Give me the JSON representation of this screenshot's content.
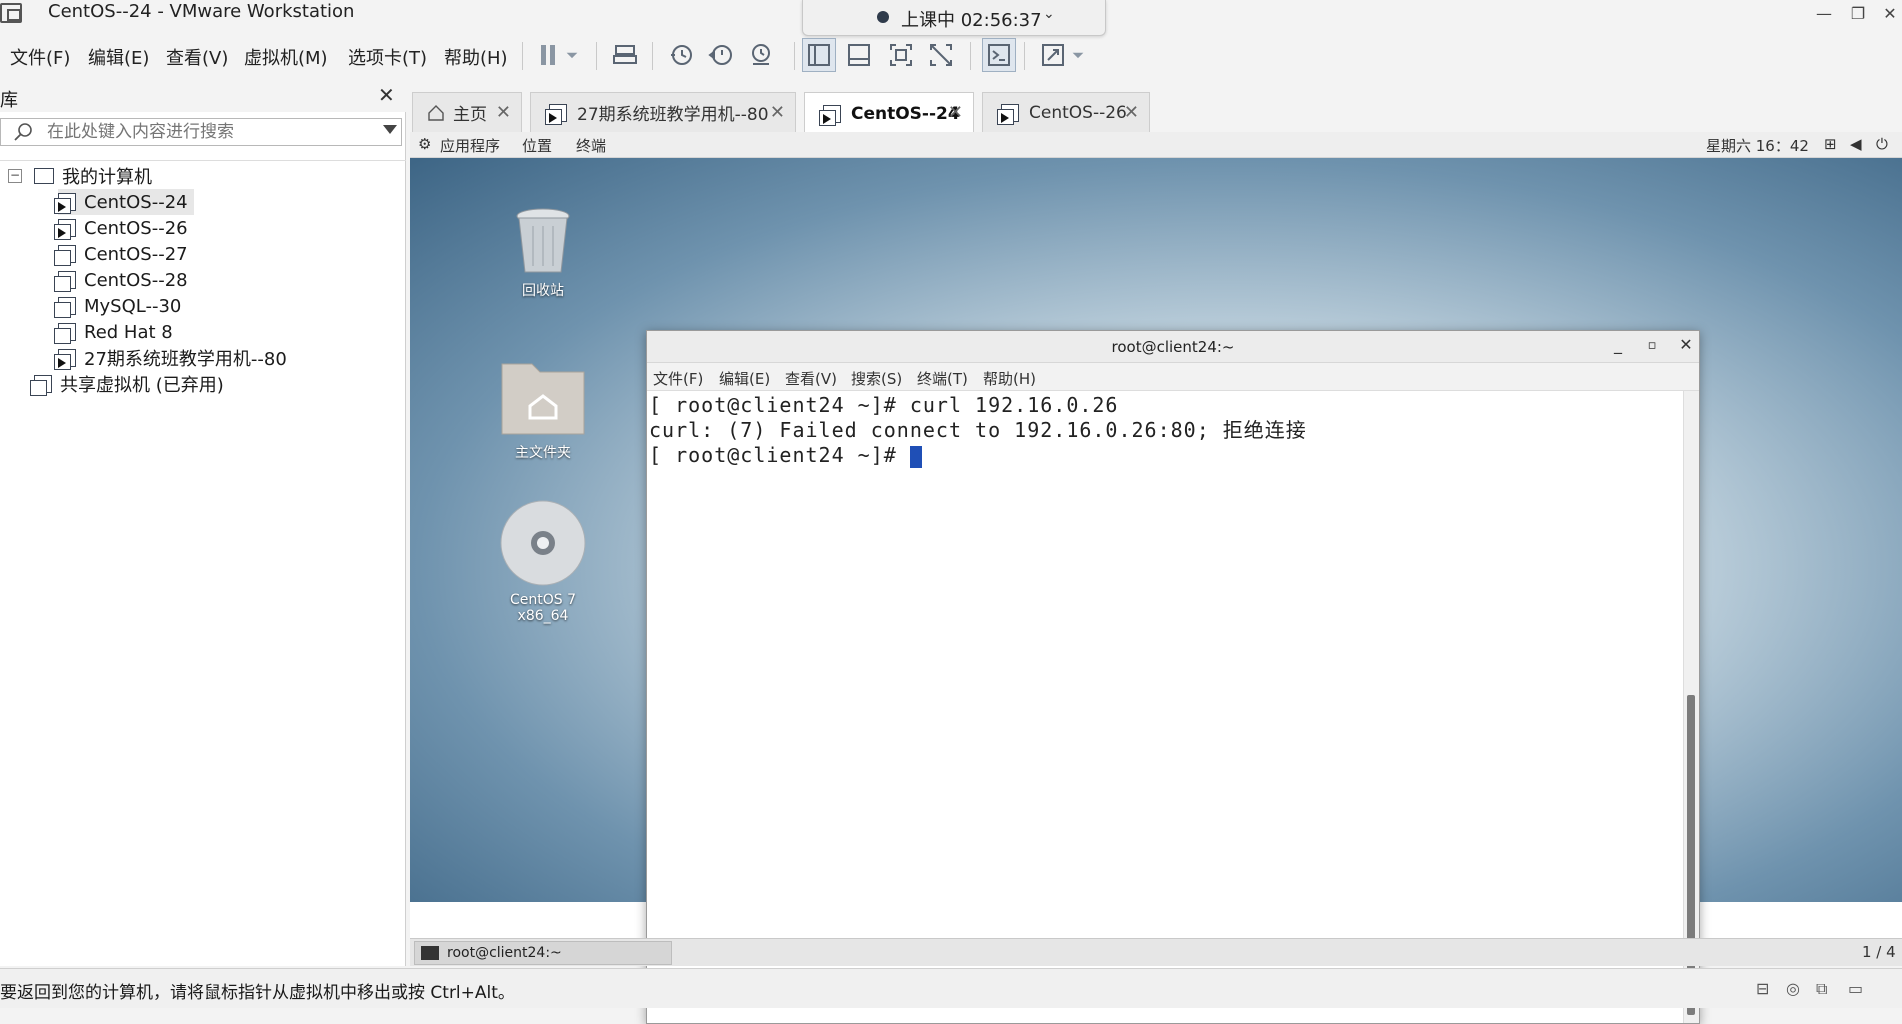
{
  "window": {
    "title": "CentOS--24 - VMware Workstation",
    "min": "—",
    "max": "❐",
    "close": "✕"
  },
  "recording": {
    "text": "上课中 02:56:37",
    "chevron": "⌄"
  },
  "menu": [
    "文件(F)",
    "编辑(E)",
    "查看(V)",
    "虚拟机(M)",
    "选项卡(T)",
    "帮助(H)"
  ],
  "library": {
    "title": "库",
    "close": "✕",
    "search_placeholder": "在此处键入内容进行搜索",
    "root": "我的计算机",
    "items": [
      {
        "label": "CentOS--24",
        "running": true
      },
      {
        "label": "CentOS--26",
        "running": true
      },
      {
        "label": "CentOS--27",
        "running": false
      },
      {
        "label": "CentOS--28",
        "running": false
      },
      {
        "label": "MySQL--30",
        "running": false
      },
      {
        "label": "Red Hat 8",
        "running": false
      },
      {
        "label": "27期系统班教学用机--80",
        "running": true
      }
    ],
    "shared": "共享虚拟机 (已弃用)"
  },
  "tabs": [
    {
      "label": "主页",
      "active": false
    },
    {
      "label": "27期系统班教学用机--80",
      "active": false
    },
    {
      "label": "CentOS--24",
      "active": true
    },
    {
      "label": "CentOS--26",
      "active": false
    }
  ],
  "gnome": {
    "apps": "应用程序",
    "places": "位置",
    "terminal": "终端",
    "clock": "星期六 16：42"
  },
  "desktop_icons": [
    "回收站",
    "主文件夹",
    "CentOS 7 x86_64"
  ],
  "terminal": {
    "title": "root@client24:~",
    "menu": [
      "文件(F)",
      "编辑(E)",
      "查看(V)",
      "搜索(S)",
      "终端(T)",
      "帮助(H)"
    ],
    "lines": [
      "[ root@client24 ~]# curl 192.16.0.26",
      "curl: (7) Failed connect to 192.16.0.26:80; 拒绝连接",
      "[ root@client24 ~]# "
    ]
  },
  "taskbar": {
    "item": "root@client24:~",
    "pager": "1 / 4"
  },
  "status": {
    "text": "要返回到您的计算机，请将鼠标指针从虚拟机中移出或按 Ctrl+Alt。"
  }
}
